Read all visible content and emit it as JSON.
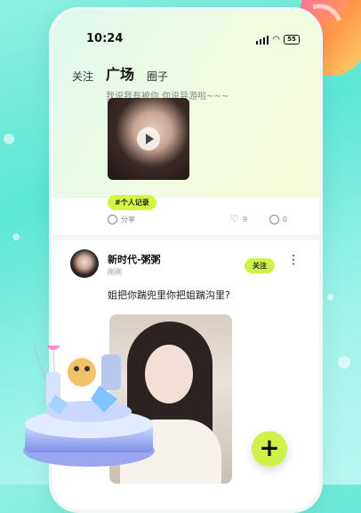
{
  "status_bar": {
    "time": "10:24",
    "battery": "55"
  },
  "tabs": [
    {
      "label": "关注"
    },
    {
      "label": "广场"
    },
    {
      "label": "圈子"
    }
  ],
  "post1": {
    "truncated_text": "我说我有被你  你说导游啦~~~",
    "tag": "#个人记录",
    "share_label": "分享",
    "likes": "9",
    "comments": "0"
  },
  "post2": {
    "username": "新时代-粥粥",
    "time": "刚刚",
    "follow_label": "关注",
    "text": "姐把你踹兜里你把姐踹沟里?"
  },
  "fab": {
    "label": "+"
  },
  "colors": {
    "accent": "#cff24a",
    "background": "#5be6d6"
  }
}
